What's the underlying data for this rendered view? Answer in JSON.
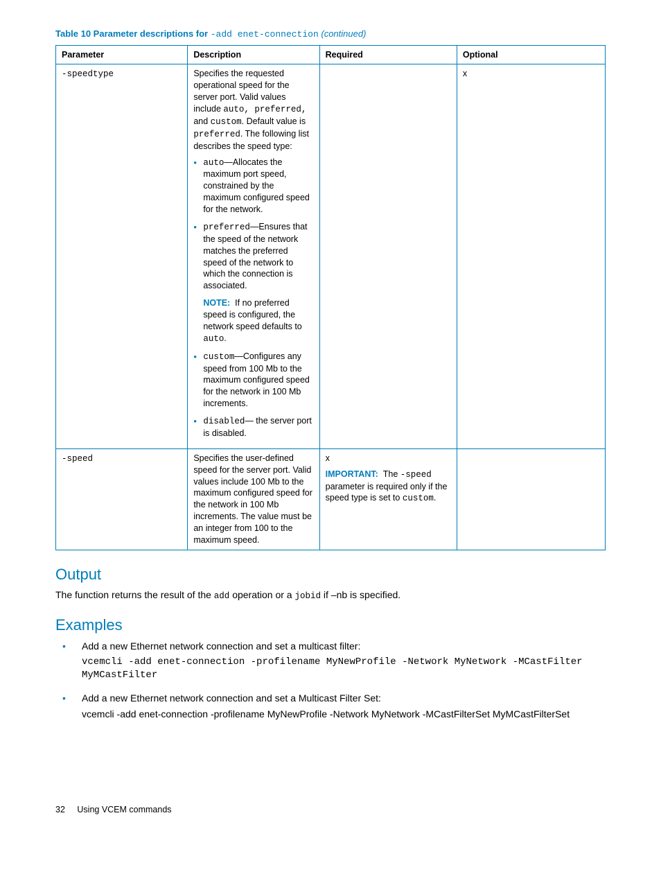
{
  "caption": {
    "prefix": "Table 10 Parameter descriptions for ",
    "code": "-add enet-connection",
    "suffix": " (continued)"
  },
  "headers": [
    "Parameter",
    "Description",
    "Required",
    "Optional"
  ],
  "row1": {
    "param": "-speedtype",
    "desc_intro_a": "Specifies the requested operational speed for the server port. Valid values include ",
    "desc_intro_codes": "auto, preferred,",
    "desc_intro_b": " and ",
    "desc_intro_code2": "custom",
    "desc_intro_c": ". Default value is ",
    "desc_intro_code3": "preferred",
    "desc_intro_d": ". The following list describes the speed type:",
    "li1_code": "auto",
    "li1_text": "—Allocates the maximum port speed, constrained by the maximum configured speed for the network.",
    "li2_code": "preferred",
    "li2_text": "—Ensures that the speed of the network matches the preferred speed of the network to which the connection is associated.",
    "note_label": "NOTE:",
    "note_text_a": "If no preferred speed is configured, the network speed defaults to ",
    "note_text_code": "auto",
    "note_text_b": ".",
    "li3_code": "custom",
    "li3_text": "—Configures any speed from 100 Mb to the maximum configured speed for the network in 100 Mb increments.",
    "li4_code": "disabled",
    "li4_text": "— the server port is disabled.",
    "required": "",
    "optional": "x"
  },
  "row2": {
    "param": "-speed",
    "desc": "Specifies the user-defined speed for the server port. Valid values include 100 Mb to the maximum configured speed for the network in 100 Mb increments. The value must be an integer from 100 to the maximum speed.",
    "req_x": "x",
    "important_label": "IMPORTANT:",
    "important_a": "The ",
    "important_code1": "-speed",
    "important_b": " parameter is required only if the speed type is set to ",
    "important_code2": "custom",
    "important_c": ".",
    "optional": ""
  },
  "output": {
    "heading": "Output",
    "text_a": "The function returns the result of the ",
    "code1": "add",
    "text_b": " operation or a ",
    "code2": "jobid",
    "text_c": " if ",
    "code3": "–nb",
    "text_d": " is specified."
  },
  "examples": {
    "heading": "Examples",
    "ex1_text": "Add a new Ethernet network connection and set a multicast filter:",
    "ex1_code": "vcemcli -add enet-connection -profilename MyNewProfile -Network MyNetwork -MCastFilter MyMCastFilter",
    "ex2_text": "Add a new Ethernet network connection and set a Multicast Filter Set:",
    "ex2_code": "vcemcli -add enet-connection -profilename MyNewProfile -Network MyNetwork -MCastFilterSet MyMCastFilterSet"
  },
  "footer": {
    "page": "32",
    "section": "Using VCEM commands"
  }
}
